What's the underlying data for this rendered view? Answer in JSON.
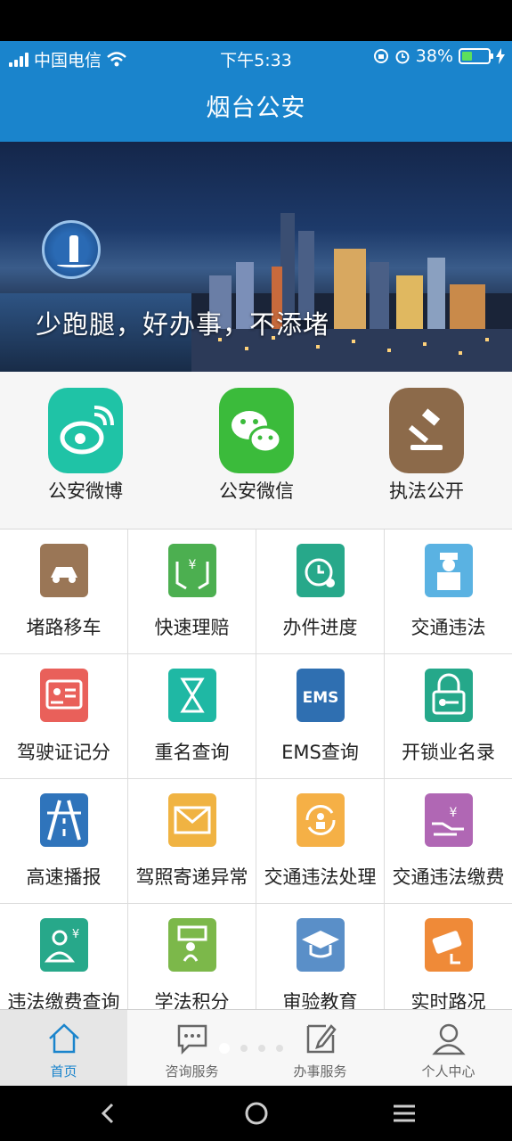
{
  "status_bar": {
    "carrier": "中国电信",
    "time": "下午5:33",
    "battery_percent": "38%",
    "battery_level": 0.38,
    "icons": [
      "signal-icon",
      "wifi-icon",
      "rotation-lock-icon",
      "alarm-icon",
      "battery-icon",
      "charging-icon"
    ]
  },
  "header": {
    "title": "烟台公安"
  },
  "banner": {
    "slogan": "少跑腿，好办事，不添堵"
  },
  "quick_links": [
    {
      "label": "公安微博",
      "icon": "weibo-icon",
      "color": "#1fc3a6"
    },
    {
      "label": "公安微信",
      "icon": "wechat-icon",
      "color": "#3bbb3b"
    },
    {
      "label": "执法公开",
      "icon": "gavel-icon",
      "color": "#8c6a4a"
    }
  ],
  "services": [
    {
      "label": "堵路移车",
      "icon": "car-icon",
      "color": "#9a7656"
    },
    {
      "label": "快速理赔",
      "icon": "money-hands-icon",
      "color": "#4caf50"
    },
    {
      "label": "办件进度",
      "icon": "progress-timer-icon",
      "color": "#27a88a"
    },
    {
      "label": "交通违法",
      "icon": "police-officer-icon",
      "color": "#5ab2e2"
    },
    {
      "label": "驾驶证记分",
      "icon": "id-card-icon",
      "color": "#e9605a"
    },
    {
      "label": "重名查询",
      "icon": "hourglass-icon",
      "color": "#1fb8a4"
    },
    {
      "label": "EMS查询",
      "icon": "ems-icon",
      "color": "#2f6fb1"
    },
    {
      "label": "开锁业名录",
      "icon": "lock-key-icon",
      "color": "#25a88a"
    },
    {
      "label": "高速播报",
      "icon": "highway-icon",
      "color": "#2f74bb"
    },
    {
      "label": "驾照寄递异常",
      "icon": "envelope-icon",
      "color": "#f0b342"
    },
    {
      "label": "交通违法处理",
      "icon": "refresh-person-icon",
      "color": "#f5b046"
    },
    {
      "label": "交通违法缴费",
      "icon": "payment-hand-icon",
      "color": "#b067b4"
    },
    {
      "label": "违法缴费查询",
      "icon": "person-yuan-icon",
      "color": "#27a88a"
    },
    {
      "label": "学法积分",
      "icon": "study-person-icon",
      "color": "#7cb84a"
    },
    {
      "label": "审验教育",
      "icon": "graduation-cap-icon",
      "color": "#5a8fc8"
    },
    {
      "label": "实时路况",
      "icon": "camera-icon",
      "color": "#ef8a38"
    }
  ],
  "tabbar": {
    "tabs": [
      {
        "label": "首页",
        "icon": "home-icon",
        "active": true
      },
      {
        "label": "咨询服务",
        "icon": "chat-icon",
        "active": false
      },
      {
        "label": "办事服务",
        "icon": "edit-icon",
        "active": false
      },
      {
        "label": "个人中心",
        "icon": "user-icon",
        "active": false
      }
    ]
  },
  "system_nav": {
    "buttons": [
      "back-icon",
      "home-circle-icon",
      "menu-icon"
    ]
  }
}
